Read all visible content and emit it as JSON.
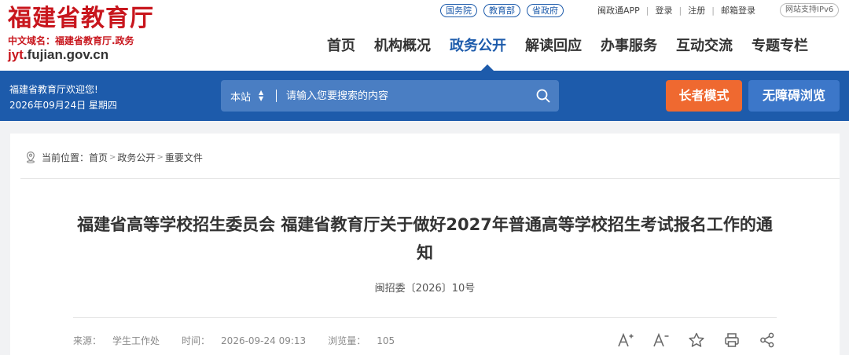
{
  "logo": {
    "title": "福建省教育厅",
    "domain": "中文域名：福建省教育厅.政务",
    "url_prefix": "jyt",
    "url_rest": ".fujian.gov.cn"
  },
  "top_links": [
    "国务院",
    "教育部",
    "省政府"
  ],
  "utility": {
    "app": "闽政通APP",
    "login": "登录",
    "register": "注册",
    "mail": "邮箱登录",
    "ipv6": "网站支持IPv6"
  },
  "nav": {
    "items": [
      "首页",
      "机构概况",
      "政务公开",
      "解读回应",
      "办事服务",
      "互动交流",
      "专题专栏"
    ],
    "active_index": 2
  },
  "welcome": {
    "line1": "福建省教育厅欢迎您!",
    "line2": "2026年09月24日 星期四"
  },
  "search": {
    "scope": "本站",
    "placeholder": "请输入您要搜索的内容"
  },
  "buttons": {
    "elder": "长者模式",
    "accessible": "无障碍浏览"
  },
  "breadcrumb": {
    "label": "当前位置：",
    "items": [
      "首页",
      "政务公开",
      "重要文件"
    ]
  },
  "article": {
    "title": "福建省高等学校招生委员会 福建省教育厅关于做好2027年普通高等学校招生考试报名工作的通知",
    "doc_number": "闽招委〔2026〕10号",
    "source_label": "来源：",
    "source": "学生工作处",
    "time_label": "时间：",
    "time": "2026-09-24 09:13",
    "views_label": "浏览量：",
    "views": "105"
  },
  "colors": {
    "brand_red": "#c8161d",
    "brand_blue": "#1d5bab",
    "elder_orange": "#ef6930",
    "accessible_blue": "#3c77c9"
  },
  "icons": [
    "location-icon",
    "search-icon",
    "font-increase-icon",
    "font-decrease-icon",
    "star-icon",
    "print-icon",
    "share-icon"
  ]
}
